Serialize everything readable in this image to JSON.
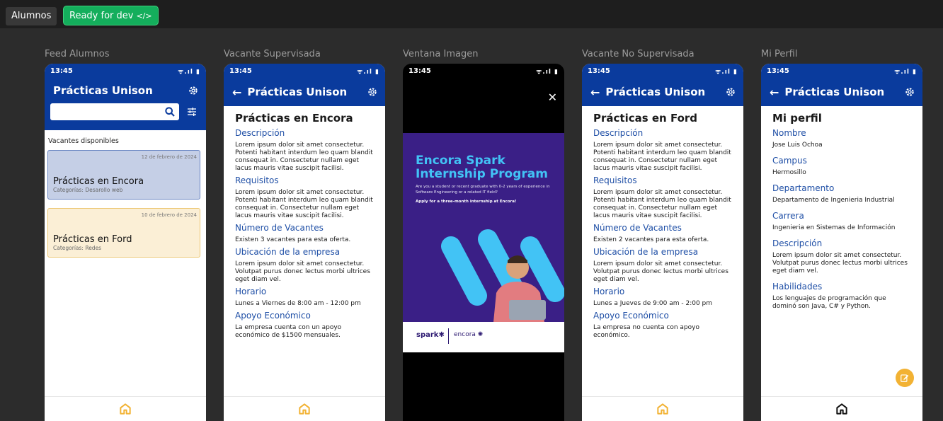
{
  "top": {
    "page_name": "Alumnos",
    "status_label": "Ready for dev",
    "status_icon": "</>"
  },
  "common": {
    "time": "13:45",
    "status_icons": "ᯤ.ıl ▮",
    "app_title": "Prácticas Unison",
    "back_arrow": "←",
    "close": "✕",
    "accent": "#0a3b9d",
    "nav_active": "#f2b233"
  },
  "frames": {
    "feed": {
      "label": "Feed Alumnos"
    },
    "vacante_sup": {
      "label": "Vacante Supervisada"
    },
    "imagen": {
      "label": "Ventana Imagen"
    },
    "vacante_nosup": {
      "label": "Vacante No Supervisada"
    },
    "perfil": {
      "label": "Mi Perfil"
    }
  },
  "feed": {
    "search_placeholder": "",
    "section_label": "Vacantes disponibles",
    "cards": [
      {
        "date": "12 de febrero de 2024",
        "title": "Prácticas en Encora",
        "category": "Categorías: Desarollo web"
      },
      {
        "date": "10 de febrero de 2024",
        "title": "Prácticas en Ford",
        "category": "Categorías: Redes"
      }
    ]
  },
  "vacante_sup": {
    "title": "Prácticas en Encora",
    "sections": [
      {
        "heading": "Descripción",
        "text": "Lorem ipsum dolor sit amet consectetur. Potenti habitant interdum leo quam blandit consequat in. Consectetur nullam eget lacus mauris vitae suscipit facilisi."
      },
      {
        "heading": "Requisitos",
        "text": "Lorem ipsum dolor sit amet consectetur. Potenti habitant interdum leo quam blandit consequat in. Consectetur nullam eget lacus mauris vitae suscipit facilisi."
      },
      {
        "heading": "Número de Vacantes",
        "text": "Existen 3 vacantes para esta oferta."
      },
      {
        "heading": "Ubicación de la empresa",
        "text": "Lorem ipsum dolor sit amet consectetur. Volutpat purus donec lectus morbi ultrices eget diam vel."
      },
      {
        "heading": "Horario",
        "text": "Lunes a Viernes de 8:00 am - 12:00 pm"
      },
      {
        "heading": "Apoyo Económico",
        "text": "La empresa cuenta con un apoyo económico de $1500 mensuales."
      }
    ]
  },
  "imagen": {
    "banner_title": "Encora Spark Internship Program",
    "banner_sub": "Are you a student or recent graduate with 0-2 years of experience in Software Engineering or a related IT field?",
    "banner_apply": "Apply for a three-month internship at Encora!",
    "brand_spark": "spark✱",
    "brand_encora": "encora ✺"
  },
  "vacante_nosup": {
    "title": "Prácticas en Ford",
    "sections": [
      {
        "heading": "Descripción",
        "text": "Lorem ipsum dolor sit amet consectetur. Potenti habitant interdum leo quam blandit consequat in. Consectetur nullam eget lacus mauris vitae suscipit facilisi."
      },
      {
        "heading": "Requisitos",
        "text": "Lorem ipsum dolor sit amet consectetur. Potenti habitant interdum leo quam blandit consequat in. Consectetur nullam eget lacus mauris vitae suscipit facilisi."
      },
      {
        "heading": "Número de Vacantes",
        "text": "Existen 2 vacantes para esta oferta."
      },
      {
        "heading": "Ubicación de la empresa",
        "text": "Lorem ipsum dolor sit amet consectetur. Volutpat purus donec lectus morbi ultrices eget diam vel."
      },
      {
        "heading": "Horario",
        "text": "Lunes a Jueves de 9:00 am - 2:00 pm"
      },
      {
        "heading": "Apoyo Económico",
        "text": "La empresa no cuenta con apoyo económico."
      }
    ]
  },
  "perfil": {
    "title": "Mi perfil",
    "sections": [
      {
        "heading": "Nombre",
        "text": "Jose Luis Ochoa"
      },
      {
        "heading": "Campus",
        "text": "Hermosillo"
      },
      {
        "heading": "Departamento",
        "text": "Departamento de Ingenieria Industrial"
      },
      {
        "heading": "Carrera",
        "text": "Ingenieria en Sistemas de Información"
      },
      {
        "heading": "Descripción",
        "text": "Lorem ipsum dolor sit amet consectetur. Volutpat purus donec lectus morbi ultrices eget diam vel."
      },
      {
        "heading": "Habilidades",
        "text": "Los lenguajes de programación que dominó son Java, C# y Python."
      }
    ]
  }
}
